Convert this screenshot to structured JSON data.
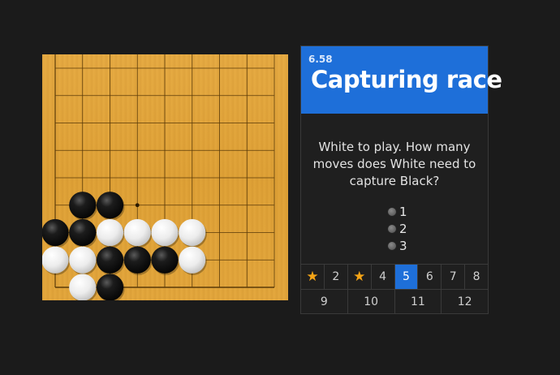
{
  "problem": {
    "number": "6.58",
    "title": "Capturing race",
    "question": "White to play. How many moves does White need to capture Black?",
    "options": [
      "1",
      "2",
      "3"
    ]
  },
  "board": {
    "size": 19,
    "visible_cols": [
      10,
      18
    ],
    "visible_rows": [
      10,
      18
    ],
    "star_point": [
      13,
      15
    ],
    "stones": [
      {
        "color": "black",
        "col": 11,
        "row": 15
      },
      {
        "color": "black",
        "col": 12,
        "row": 15
      },
      {
        "color": "black",
        "col": 10,
        "row": 16
      },
      {
        "color": "black",
        "col": 11,
        "row": 16
      },
      {
        "color": "white",
        "col": 12,
        "row": 16
      },
      {
        "color": "white",
        "col": 13,
        "row": 16
      },
      {
        "color": "white",
        "col": 14,
        "row": 16
      },
      {
        "color": "white",
        "col": 15,
        "row": 16
      },
      {
        "color": "white",
        "col": 10,
        "row": 17
      },
      {
        "color": "white",
        "col": 11,
        "row": 17
      },
      {
        "color": "black",
        "col": 12,
        "row": 17
      },
      {
        "color": "black",
        "col": 13,
        "row": 17
      },
      {
        "color": "black",
        "col": 14,
        "row": 17
      },
      {
        "color": "white",
        "col": 15,
        "row": 17
      },
      {
        "color": "white",
        "col": 11,
        "row": 18
      },
      {
        "color": "black",
        "col": 12,
        "row": 18
      }
    ]
  },
  "nav": {
    "row1": [
      {
        "label": "",
        "icon": "star-icon",
        "solved": true
      },
      {
        "label": "2"
      },
      {
        "label": "",
        "icon": "star-icon",
        "solved": true
      },
      {
        "label": "4"
      },
      {
        "label": "5",
        "active": true
      },
      {
        "label": "6"
      },
      {
        "label": "7"
      },
      {
        "label": "8"
      }
    ],
    "row2": [
      {
        "label": "9"
      },
      {
        "label": "10"
      },
      {
        "label": "11"
      },
      {
        "label": "12"
      }
    ]
  },
  "colors": {
    "accent": "#1e6fd9",
    "board": "#e0a43a",
    "star": "#f4a416",
    "background": "#1b1b1b"
  }
}
